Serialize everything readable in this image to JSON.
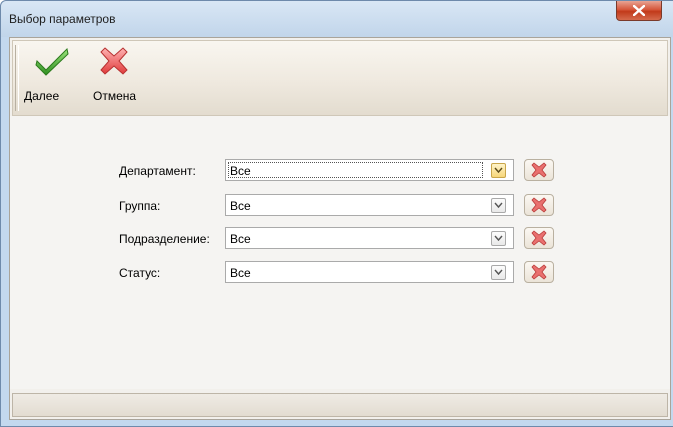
{
  "window": {
    "title": "Выбор параметров"
  },
  "toolbar": {
    "next_label": "Далее",
    "cancel_label": "Отмена"
  },
  "form": {
    "fields": [
      {
        "label": "Департамент:",
        "value": "Все"
      },
      {
        "label": "Группа:",
        "value": "Все"
      },
      {
        "label": "Подразделение:",
        "value": "Все"
      },
      {
        "label": "Статус:",
        "value": "Все"
      }
    ]
  },
  "icons": {
    "next": "green-checkmark-icon",
    "cancel": "red-cross-icon",
    "dropdown": "chevron-down-icon",
    "clear": "clear-cross-icon",
    "close": "close-icon"
  },
  "colors": {
    "accent_green": "#3aa12a",
    "cancel_red": "#e04a4a",
    "close_button": "#c13a1a"
  }
}
